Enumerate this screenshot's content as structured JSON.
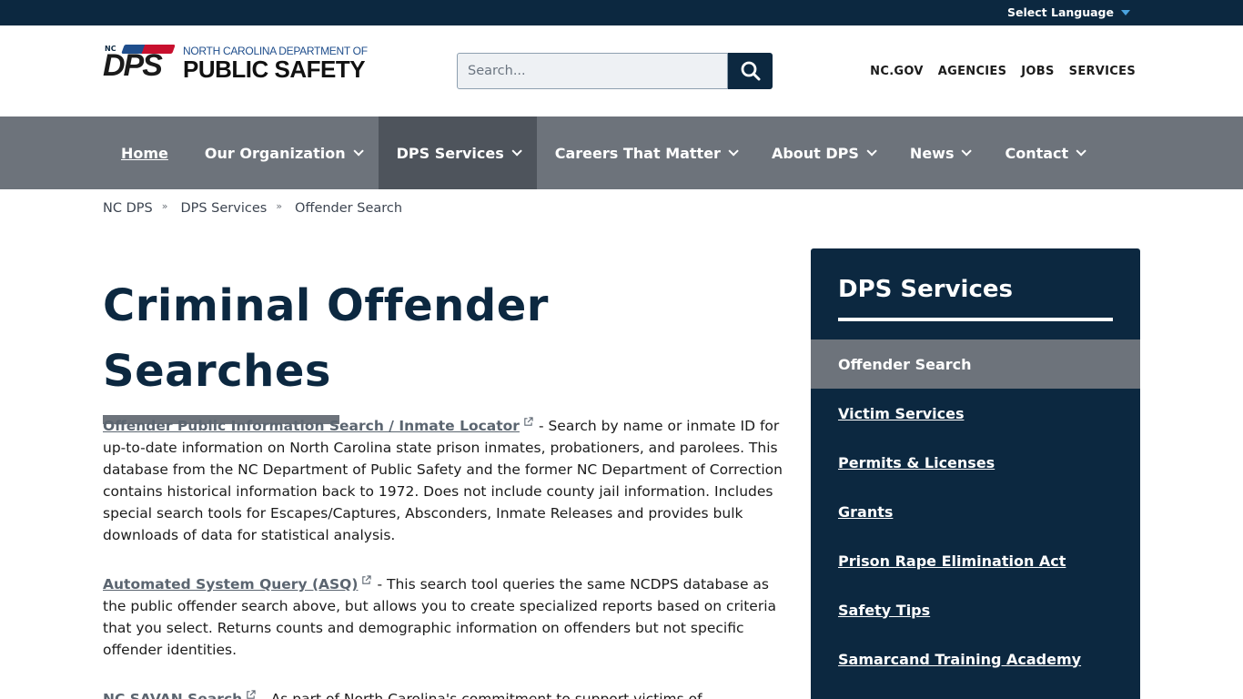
{
  "topbar": {
    "language_label": "Select Language"
  },
  "header": {
    "logo_badge": "NC",
    "logo_letters": "DPS",
    "logo_top": "NORTH CAROLINA DEPARTMENT OF",
    "logo_bottom": "PUBLIC SAFETY",
    "search_placeholder": "Search...",
    "utility_links": [
      "NC.GOV",
      "AGENCIES",
      "JOBS",
      "SERVICES"
    ]
  },
  "nav": {
    "items": [
      {
        "label": "Home"
      },
      {
        "label": "Our Organization"
      },
      {
        "label": "DPS Services"
      },
      {
        "label": "Careers That Matter"
      },
      {
        "label": "About DPS"
      },
      {
        "label": "News"
      },
      {
        "label": "Contact"
      }
    ]
  },
  "breadcrumb": {
    "items": [
      "NC DPS",
      "DPS Services",
      "Offender Search"
    ],
    "separator": "»"
  },
  "main": {
    "title": "Criminal Offender Searches",
    "entries": [
      {
        "link": "Offender Public Information Search / Inmate Locator",
        "text": "-  Search by name or inmate ID for up-to-date information on North Carolina state prison inmates, probationers, and parolees.  This database from the NC Department of Public Safety and the former NC Department of Correction contains historical information back to 1972.  Does not include county jail information.  Includes special search tools for Escapes/Captures, Absconders, Inmate Releases and provides bulk downloads of data for statistical analysis."
      },
      {
        "link": "Automated System Query (ASQ)",
        "text": "- This search tool queries the same NCDPS database as the public offender search above, but allows you to create specialized reports based on criteria that you select.  Returns counts and demographic information on offenders but not specific offender identities."
      },
      {
        "link": "NC SAVAN Search",
        "text": "- As part of North Carolina's commitment to support victims of"
      }
    ]
  },
  "sidebar": {
    "title": "DPS Services",
    "items": [
      {
        "label": "Offender Search"
      },
      {
        "label": "Victim Services"
      },
      {
        "label": "Permits & Licenses"
      },
      {
        "label": "Grants"
      },
      {
        "label": "Prison Rape Elimination Act"
      },
      {
        "label": "Safety Tips"
      },
      {
        "label": "Samarcand Training Academy"
      }
    ]
  },
  "colors": {
    "navy": "#0c2840",
    "nav_gray": "#6d737b",
    "nav_active": "#4e545c",
    "link_gray": "#5b6570"
  }
}
